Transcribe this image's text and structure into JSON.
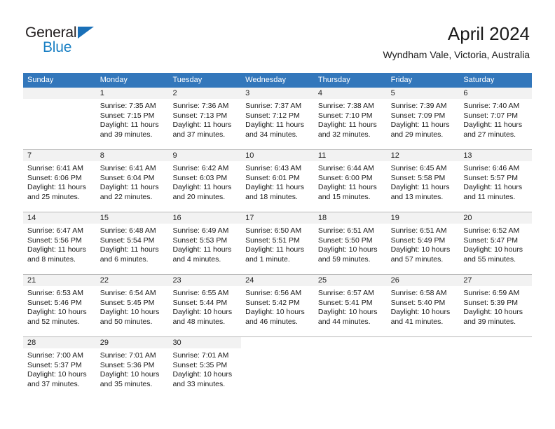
{
  "brand": {
    "name_part1": "General",
    "name_part2": "Blue",
    "triangle_color": "#1a70b8",
    "text_color": "#231f20",
    "blue_color": "#1a80c4"
  },
  "header": {
    "title": "April 2024",
    "subtitle": "Wyndham Vale, Victoria, Australia"
  },
  "theme": {
    "header_row_bg": "#3377bb",
    "daynum_bg": "#f2f2f2",
    "grid_line": "#b8b8b8"
  },
  "weekdays": [
    "Sunday",
    "Monday",
    "Tuesday",
    "Wednesday",
    "Thursday",
    "Friday",
    "Saturday"
  ],
  "labels": {
    "sunrise_prefix": "Sunrise:",
    "sunset_prefix": "Sunset:",
    "daylight_prefix": "Daylight:"
  },
  "weeks": [
    [
      {
        "day": "",
        "empty": true,
        "sunrise": "",
        "sunset": "",
        "daylight_line1": "",
        "daylight_line2": ""
      },
      {
        "day": "1",
        "sunrise": "Sunrise: 7:35 AM",
        "sunset": "Sunset: 7:15 PM",
        "daylight_line1": "Daylight: 11 hours",
        "daylight_line2": "and 39 minutes."
      },
      {
        "day": "2",
        "sunrise": "Sunrise: 7:36 AM",
        "sunset": "Sunset: 7:13 PM",
        "daylight_line1": "Daylight: 11 hours",
        "daylight_line2": "and 37 minutes."
      },
      {
        "day": "3",
        "sunrise": "Sunrise: 7:37 AM",
        "sunset": "Sunset: 7:12 PM",
        "daylight_line1": "Daylight: 11 hours",
        "daylight_line2": "and 34 minutes."
      },
      {
        "day": "4",
        "sunrise": "Sunrise: 7:38 AM",
        "sunset": "Sunset: 7:10 PM",
        "daylight_line1": "Daylight: 11 hours",
        "daylight_line2": "and 32 minutes."
      },
      {
        "day": "5",
        "sunrise": "Sunrise: 7:39 AM",
        "sunset": "Sunset: 7:09 PM",
        "daylight_line1": "Daylight: 11 hours",
        "daylight_line2": "and 29 minutes."
      },
      {
        "day": "6",
        "sunrise": "Sunrise: 7:40 AM",
        "sunset": "Sunset: 7:07 PM",
        "daylight_line1": "Daylight: 11 hours",
        "daylight_line2": "and 27 minutes."
      }
    ],
    [
      {
        "day": "7",
        "sunrise": "Sunrise: 6:41 AM",
        "sunset": "Sunset: 6:06 PM",
        "daylight_line1": "Daylight: 11 hours",
        "daylight_line2": "and 25 minutes."
      },
      {
        "day": "8",
        "sunrise": "Sunrise: 6:41 AM",
        "sunset": "Sunset: 6:04 PM",
        "daylight_line1": "Daylight: 11 hours",
        "daylight_line2": "and 22 minutes."
      },
      {
        "day": "9",
        "sunrise": "Sunrise: 6:42 AM",
        "sunset": "Sunset: 6:03 PM",
        "daylight_line1": "Daylight: 11 hours",
        "daylight_line2": "and 20 minutes."
      },
      {
        "day": "10",
        "sunrise": "Sunrise: 6:43 AM",
        "sunset": "Sunset: 6:01 PM",
        "daylight_line1": "Daylight: 11 hours",
        "daylight_line2": "and 18 minutes."
      },
      {
        "day": "11",
        "sunrise": "Sunrise: 6:44 AM",
        "sunset": "Sunset: 6:00 PM",
        "daylight_line1": "Daylight: 11 hours",
        "daylight_line2": "and 15 minutes."
      },
      {
        "day": "12",
        "sunrise": "Sunrise: 6:45 AM",
        "sunset": "Sunset: 5:58 PM",
        "daylight_line1": "Daylight: 11 hours",
        "daylight_line2": "and 13 minutes."
      },
      {
        "day": "13",
        "sunrise": "Sunrise: 6:46 AM",
        "sunset": "Sunset: 5:57 PM",
        "daylight_line1": "Daylight: 11 hours",
        "daylight_line2": "and 11 minutes."
      }
    ],
    [
      {
        "day": "14",
        "sunrise": "Sunrise: 6:47 AM",
        "sunset": "Sunset: 5:56 PM",
        "daylight_line1": "Daylight: 11 hours",
        "daylight_line2": "and 8 minutes."
      },
      {
        "day": "15",
        "sunrise": "Sunrise: 6:48 AM",
        "sunset": "Sunset: 5:54 PM",
        "daylight_line1": "Daylight: 11 hours",
        "daylight_line2": "and 6 minutes."
      },
      {
        "day": "16",
        "sunrise": "Sunrise: 6:49 AM",
        "sunset": "Sunset: 5:53 PM",
        "daylight_line1": "Daylight: 11 hours",
        "daylight_line2": "and 4 minutes."
      },
      {
        "day": "17",
        "sunrise": "Sunrise: 6:50 AM",
        "sunset": "Sunset: 5:51 PM",
        "daylight_line1": "Daylight: 11 hours",
        "daylight_line2": "and 1 minute."
      },
      {
        "day": "18",
        "sunrise": "Sunrise: 6:51 AM",
        "sunset": "Sunset: 5:50 PM",
        "daylight_line1": "Daylight: 10 hours",
        "daylight_line2": "and 59 minutes."
      },
      {
        "day": "19",
        "sunrise": "Sunrise: 6:51 AM",
        "sunset": "Sunset: 5:49 PM",
        "daylight_line1": "Daylight: 10 hours",
        "daylight_line2": "and 57 minutes."
      },
      {
        "day": "20",
        "sunrise": "Sunrise: 6:52 AM",
        "sunset": "Sunset: 5:47 PM",
        "daylight_line1": "Daylight: 10 hours",
        "daylight_line2": "and 55 minutes."
      }
    ],
    [
      {
        "day": "21",
        "sunrise": "Sunrise: 6:53 AM",
        "sunset": "Sunset: 5:46 PM",
        "daylight_line1": "Daylight: 10 hours",
        "daylight_line2": "and 52 minutes."
      },
      {
        "day": "22",
        "sunrise": "Sunrise: 6:54 AM",
        "sunset": "Sunset: 5:45 PM",
        "daylight_line1": "Daylight: 10 hours",
        "daylight_line2": "and 50 minutes."
      },
      {
        "day": "23",
        "sunrise": "Sunrise: 6:55 AM",
        "sunset": "Sunset: 5:44 PM",
        "daylight_line1": "Daylight: 10 hours",
        "daylight_line2": "and 48 minutes."
      },
      {
        "day": "24",
        "sunrise": "Sunrise: 6:56 AM",
        "sunset": "Sunset: 5:42 PM",
        "daylight_line1": "Daylight: 10 hours",
        "daylight_line2": "and 46 minutes."
      },
      {
        "day": "25",
        "sunrise": "Sunrise: 6:57 AM",
        "sunset": "Sunset: 5:41 PM",
        "daylight_line1": "Daylight: 10 hours",
        "daylight_line2": "and 44 minutes."
      },
      {
        "day": "26",
        "sunrise": "Sunrise: 6:58 AM",
        "sunset": "Sunset: 5:40 PM",
        "daylight_line1": "Daylight: 10 hours",
        "daylight_line2": "and 41 minutes."
      },
      {
        "day": "27",
        "sunrise": "Sunrise: 6:59 AM",
        "sunset": "Sunset: 5:39 PM",
        "daylight_line1": "Daylight: 10 hours",
        "daylight_line2": "and 39 minutes."
      }
    ],
    [
      {
        "day": "28",
        "sunrise": "Sunrise: 7:00 AM",
        "sunset": "Sunset: 5:37 PM",
        "daylight_line1": "Daylight: 10 hours",
        "daylight_line2": "and 37 minutes."
      },
      {
        "day": "29",
        "sunrise": "Sunrise: 7:01 AM",
        "sunset": "Sunset: 5:36 PM",
        "daylight_line1": "Daylight: 10 hours",
        "daylight_line2": "and 35 minutes."
      },
      {
        "day": "30",
        "sunrise": "Sunrise: 7:01 AM",
        "sunset": "Sunset: 5:35 PM",
        "daylight_line1": "Daylight: 10 hours",
        "daylight_line2": "and 33 minutes."
      },
      {
        "day": "",
        "empty": true,
        "blank": true,
        "sunrise": "",
        "sunset": "",
        "daylight_line1": "",
        "daylight_line2": ""
      },
      {
        "day": "",
        "empty": true,
        "blank": true,
        "sunrise": "",
        "sunset": "",
        "daylight_line1": "",
        "daylight_line2": ""
      },
      {
        "day": "",
        "empty": true,
        "blank": true,
        "sunrise": "",
        "sunset": "",
        "daylight_line1": "",
        "daylight_line2": ""
      },
      {
        "day": "",
        "empty": true,
        "blank": true,
        "sunrise": "",
        "sunset": "",
        "daylight_line1": "",
        "daylight_line2": ""
      }
    ]
  ]
}
